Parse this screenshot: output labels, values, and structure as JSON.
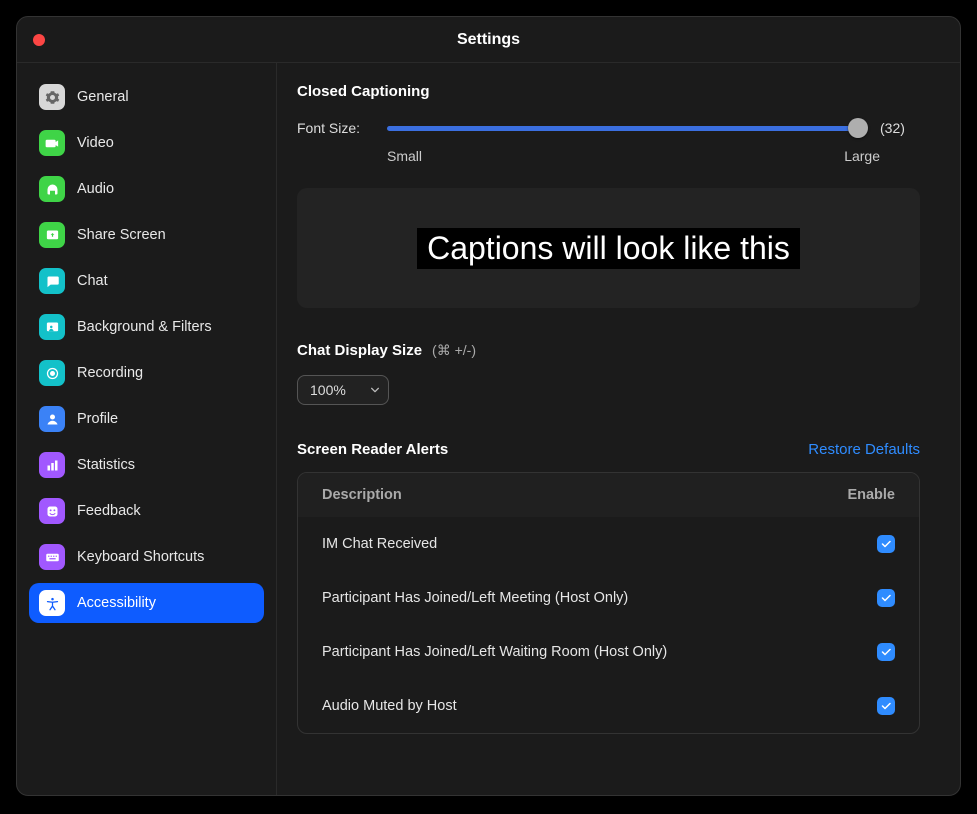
{
  "window": {
    "title": "Settings"
  },
  "sidebar": {
    "items": [
      {
        "label": "General",
        "icon": "gear-icon",
        "color": "#d8d8d8",
        "fg": "#666"
      },
      {
        "label": "Video",
        "icon": "video-icon",
        "color": "#3fd447",
        "fg": "#fff"
      },
      {
        "label": "Audio",
        "icon": "headphones-icon",
        "color": "#3fd447",
        "fg": "#fff"
      },
      {
        "label": "Share Screen",
        "icon": "share-screen-icon",
        "color": "#3fd447",
        "fg": "#fff"
      },
      {
        "label": "Chat",
        "icon": "chat-icon",
        "color": "#13c1c9",
        "fg": "#fff"
      },
      {
        "label": "Background & Filters",
        "icon": "background-icon",
        "color": "#13c1c9",
        "fg": "#fff"
      },
      {
        "label": "Recording",
        "icon": "record-icon",
        "color": "#13c1c9",
        "fg": "#fff"
      },
      {
        "label": "Profile",
        "icon": "profile-icon",
        "color": "#3b82f6",
        "fg": "#fff"
      },
      {
        "label": "Statistics",
        "icon": "statistics-icon",
        "color": "#a158ff",
        "fg": "#fff"
      },
      {
        "label": "Feedback",
        "icon": "feedback-icon",
        "color": "#a158ff",
        "fg": "#fff"
      },
      {
        "label": "Keyboard Shortcuts",
        "icon": "keyboard-icon",
        "color": "#a158ff",
        "fg": "#fff"
      },
      {
        "label": "Accessibility",
        "icon": "accessibility-icon",
        "color": "#3b82f6",
        "fg": "#fff",
        "active": true
      }
    ]
  },
  "cc": {
    "title": "Closed Captioning",
    "font_size_label": "Font Size:",
    "value_display": "(32)",
    "small_label": "Small",
    "large_label": "Large",
    "preview_text": "Captions will look like this"
  },
  "chat": {
    "title": "Chat Display Size",
    "shortcut": "(⌘ +/-)",
    "value": "100%"
  },
  "alerts": {
    "title": "Screen Reader Alerts",
    "restore_label": "Restore Defaults",
    "col_desc": "Description",
    "col_enable": "Enable",
    "rows": [
      {
        "desc": "IM Chat Received",
        "enabled": true
      },
      {
        "desc": "Participant Has Joined/Left Meeting (Host Only)",
        "enabled": true
      },
      {
        "desc": "Participant Has Joined/Left Waiting Room (Host Only)",
        "enabled": true
      },
      {
        "desc": "Audio Muted by Host",
        "enabled": true
      }
    ]
  }
}
